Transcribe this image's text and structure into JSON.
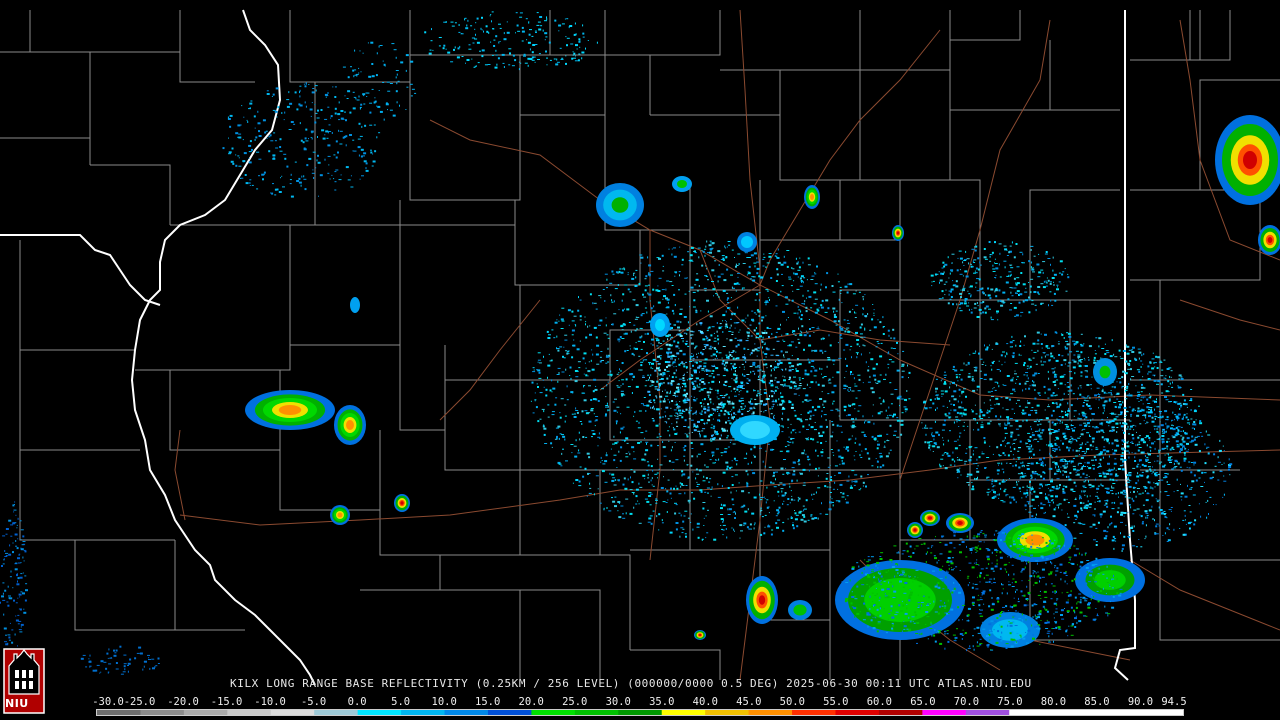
{
  "title": "KILX LONG RANGE BASE REFLECTIVITY (0.25KM / 256 LEVEL) (000000/0000 0.5 DEG) 2025-06-30 00:11 UTC  ATLAS.NIU.EDU",
  "logo": {
    "text": "NIU",
    "icon": "niu-tower-logo-icon"
  },
  "scale": {
    "labels": [
      "-30.0",
      "-25.0",
      "-20.0",
      "-15.0",
      "-10.0",
      "-5.0",
      "0.0",
      "5.0",
      "10.0",
      "15.0",
      "20.0",
      "25.0",
      "30.0",
      "35.0",
      "40.0",
      "45.0",
      "50.0",
      "55.0",
      "60.0",
      "65.0",
      "70.0",
      "75.0",
      "80.0",
      "85.0",
      "90.0",
      "94.5"
    ],
    "colors": [
      "#6e6e6e",
      "#8c8c8c",
      "#aaaaaa",
      "#c8c8c8",
      "#dcdcdc",
      "#9ec9d6",
      "#00e5ff",
      "#00b6f0",
      "#0088e8",
      "#0050d8",
      "#00e000",
      "#00c000",
      "#009800",
      "#ffff00",
      "#f0c000",
      "#ff9000",
      "#ff3000",
      "#e00000",
      "#b00000",
      "#ff00ff",
      "#a050e0",
      "#ffffff",
      "#ffffff",
      "#ffffff",
      "#ffffff"
    ]
  },
  "map": {
    "colors": {
      "background": "#000000",
      "county_lines": "#8a8a8a",
      "state_lines": "#ffffff",
      "roads": "#8b4a30"
    }
  }
}
